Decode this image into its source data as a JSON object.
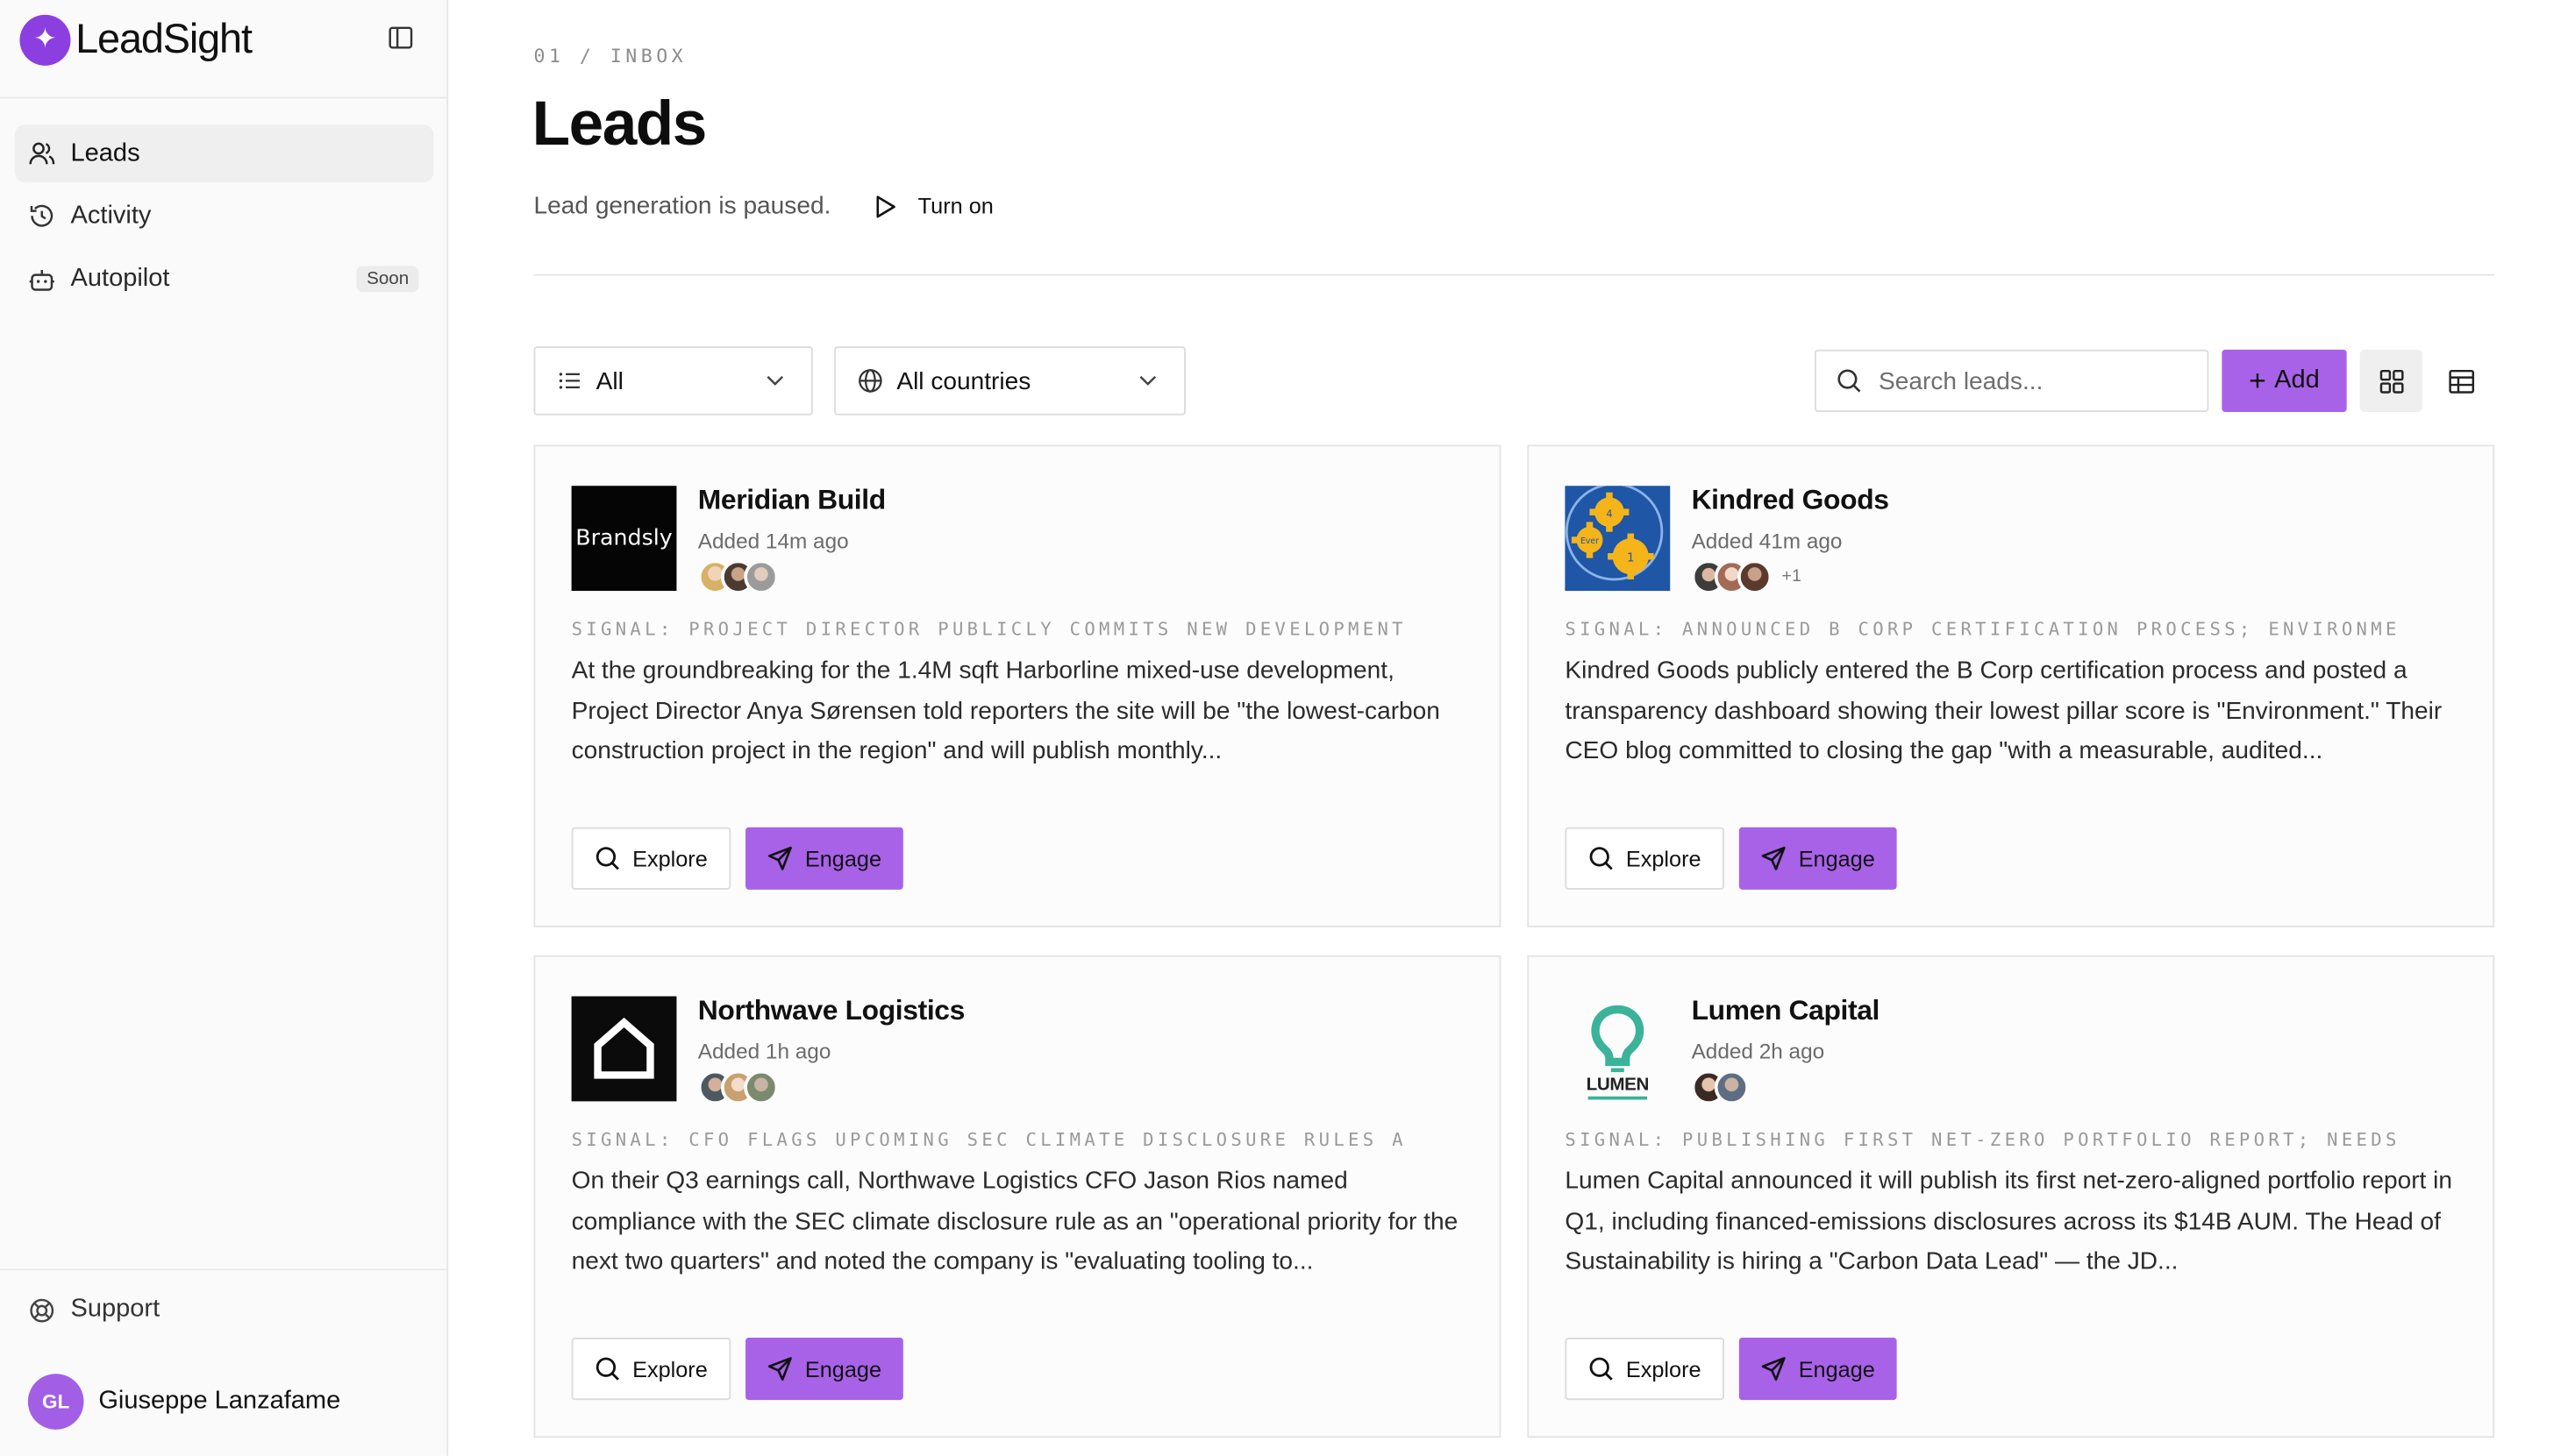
{
  "brand": {
    "name": "LeadSight",
    "accent": "#8b3fe0",
    "button_color": "#a862e8"
  },
  "sidebar": {
    "items": [
      {
        "label": "Leads",
        "icon": "users-icon",
        "active": true
      },
      {
        "label": "Activity",
        "icon": "history-icon"
      },
      {
        "label": "Autopilot",
        "icon": "bot-icon",
        "badge": "Soon"
      }
    ],
    "support_label": "Support",
    "user": {
      "initials": "GL",
      "name": "Giuseppe Lanzafame"
    }
  },
  "header": {
    "breadcrumb": "01 / INBOX",
    "title": "Leads",
    "status": "Lead generation is paused.",
    "turn_on_label": "Turn on"
  },
  "toolbar": {
    "filter_value": "All",
    "country_value": "All countries",
    "search_placeholder": "Search leads...",
    "add_label": "Add",
    "active_view": "grid"
  },
  "cards": [
    {
      "name": "Meridian Build",
      "logo_text": "Brandsly",
      "added": "Added 14m ago",
      "more": "",
      "signal": "SIGNAL: PROJECT DIRECTOR PUBLICLY COMMITS NEW DEVELOPMENT",
      "body": "At the groundbreaking for the 1.4M sqft Harborline mixed-use development, Project Director Anya Sørensen told reporters the site will be \"the lowest-carbon construction project in the region\" and will publish monthly...",
      "explore": "Explore",
      "engage": "Engage"
    },
    {
      "name": "Kindred Goods",
      "logo_text": "",
      "added": "Added 41m ago",
      "more": "+1",
      "signal": "SIGNAL: ANNOUNCED B CORP CERTIFICATION PROCESS; ENVIRONME",
      "body": "Kindred Goods publicly entered the B Corp certification process and posted a transparency dashboard showing their lowest pillar score is \"Environment.\" Their CEO blog committed to closing the gap \"with a measurable, audited...",
      "explore": "Explore",
      "engage": "Engage"
    },
    {
      "name": "Northwave Logistics",
      "logo_text": "",
      "added": "Added 1h ago",
      "more": "",
      "signal": "SIGNAL: CFO FLAGS UPCOMING SEC CLIMATE DISCLOSURE RULES A",
      "body": "On their Q3 earnings call, Northwave Logistics CFO Jason Rios named compliance with the SEC climate disclosure rule as an \"operational priority for the next two quarters\" and noted the company is \"evaluating tooling to...",
      "explore": "Explore",
      "engage": "Engage"
    },
    {
      "name": "Lumen Capital",
      "logo_text": "LUMEN",
      "added": "Added 2h ago",
      "more": "",
      "signal": "SIGNAL: PUBLISHING FIRST NET-ZERO PORTFOLIO REPORT; NEEDS",
      "body": "Lumen Capital announced it will publish its first net-zero-aligned portfolio report in Q1, including financed-emissions disclosures across its $14B AUM. The Head of Sustainability is hiring a \"Carbon Data Lead\" — the JD...",
      "explore": "Explore",
      "engage": "Engage"
    }
  ]
}
